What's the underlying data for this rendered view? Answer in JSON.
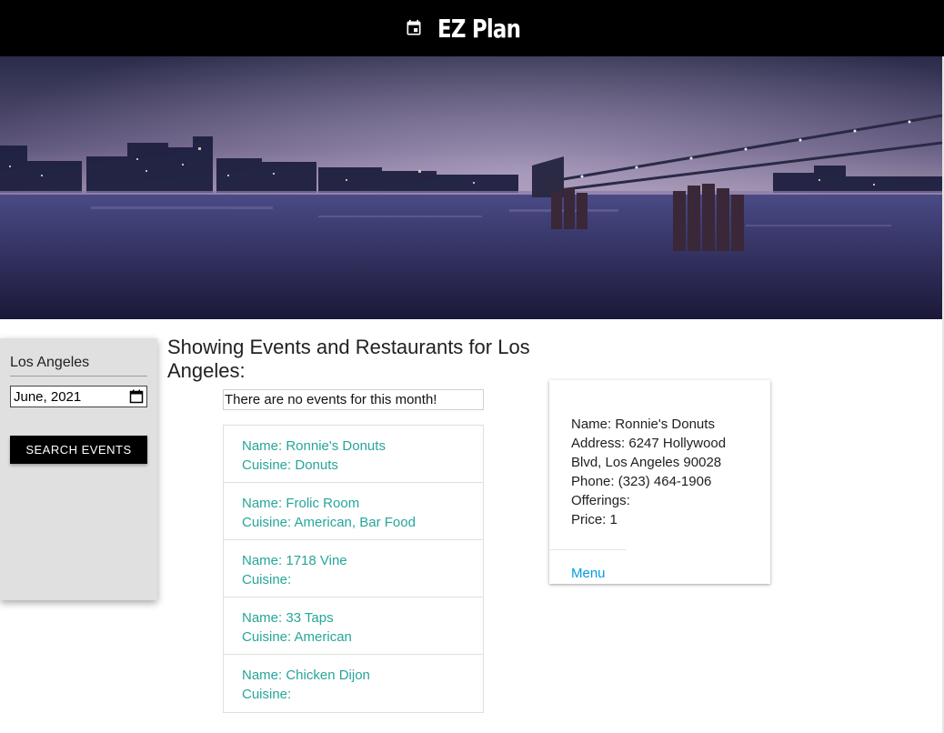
{
  "header": {
    "title": "EZ Plan",
    "icon": "calendar-event-icon"
  },
  "search": {
    "city_value": "Los Angeles",
    "date_value": "June, 2021",
    "button_label": "Search Events"
  },
  "main": {
    "heading": "Showing Events and Restaurants for Los Angeles:",
    "no_events_text": "There are no events for this month!"
  },
  "restaurants": [
    {
      "name": "Name: Ronnie's Donuts",
      "cuisine": "Cuisine: Donuts"
    },
    {
      "name": "Name: Frolic Room",
      "cuisine": "Cuisine: American, Bar Food"
    },
    {
      "name": "Name: 1718 Vine",
      "cuisine": "Cuisine:"
    },
    {
      "name": "Name: 33 Taps",
      "cuisine": "Cuisine: American"
    },
    {
      "name": "Name: Chicken Dijon",
      "cuisine": "Cuisine:"
    }
  ],
  "detail": {
    "name": "Name: Ronnie's Donuts",
    "address": "Address: 6247 Hollywood Blvd, Los Angeles 90028",
    "phone": "Phone: (323) 464-1906",
    "offerings": "Offerings:",
    "price": "Price: 1",
    "menu_link": "Menu"
  },
  "colors": {
    "header_bg": "#000000",
    "sidebar_bg": "#e0e0e0",
    "list_text": "#26a69a",
    "link": "#039be5"
  }
}
